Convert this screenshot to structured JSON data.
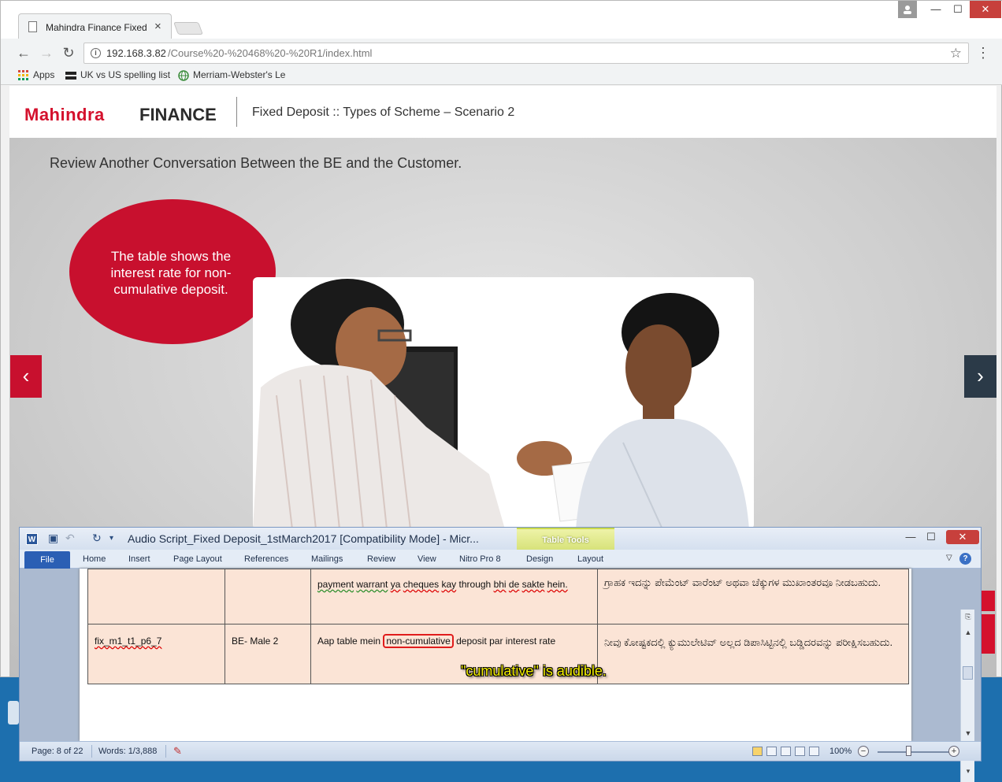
{
  "browser": {
    "tab_title": "Mahindra Finance Fixed D",
    "tab_close": "×",
    "url_host": "192.168.3.82",
    "url_path": "/Course%20-%20468%20-%20R1/index.html",
    "bookmarks": [
      {
        "label": "Apps",
        "icon": "apps-grid-icon"
      },
      {
        "label": "UK vs US spelling list",
        "icon": "flag-icon"
      },
      {
        "label": "Merriam-Webster's Le",
        "icon": "globe-icon"
      }
    ],
    "window_controls": {
      "minimize": "—",
      "maximize": "☐",
      "close": "✕"
    }
  },
  "course": {
    "logo_part1": "Mahindra",
    "logo_part2": "FINANCE",
    "title": "Fixed Deposit :: Types of Scheme – Scenario 2",
    "instruction": "Review Another Conversation Between the BE and the Customer.",
    "bubble_text": "The table shows the interest rate for non-cumulative deposit.",
    "prev_arrow": "‹",
    "next_arrow": "›"
  },
  "word": {
    "title": "Audio Script_Fixed Deposit_1stMarch2017 [Compatibility Mode]  -  Micr...",
    "table_tools": "Table Tools",
    "tabs": [
      "File",
      "Home",
      "Insert",
      "Page Layout",
      "References",
      "Mailings",
      "Review",
      "View",
      "Nitro Pro 8",
      "Design",
      "Layout"
    ],
    "table_rows": [
      {
        "id": "",
        "speaker": "",
        "script_words": [
          "payment",
          "warrant",
          "ya",
          "cheques",
          "kay",
          "through",
          "bhi",
          "de",
          "sakte",
          "hein."
        ],
        "kannada": "ಗ್ರಾಹಕ ಇದನ್ನು ಪೇಮೆಂಟ್ ವಾರೆಂಟ್ ಅಥವಾ ಚೆಕ್ಕುಗಳ ಮುಖಾಂತರವೂ ನೀಡಬಹುದು."
      },
      {
        "id": "fix_m1_t1_p6_7",
        "speaker": "BE- Male 2",
        "script_pre": "Aap table mein ",
        "script_highlight": "non-cumulative",
        "script_post": " deposit par interest rate",
        "kannada": "ನೀವು ಕೋಷ್ಟಕದಲ್ಲಿ ಕ್ಯುಮುಲೇಟಿವ್ ಅಲ್ಲದ ಡಿಪಾಸಿಟ್ಟಿನಲ್ಲಿ ಬಡ್ಡಿದರವನ್ನು ಪರೀಕ್ಷಿಸಬಹುದು."
      }
    ],
    "annotation": "\"cumulative\" is audible.",
    "status": {
      "page": "Page: 8 of 22",
      "words": "Words: 1/3,888",
      "zoom": "100%",
      "zoom_level_percent": 100
    }
  }
}
